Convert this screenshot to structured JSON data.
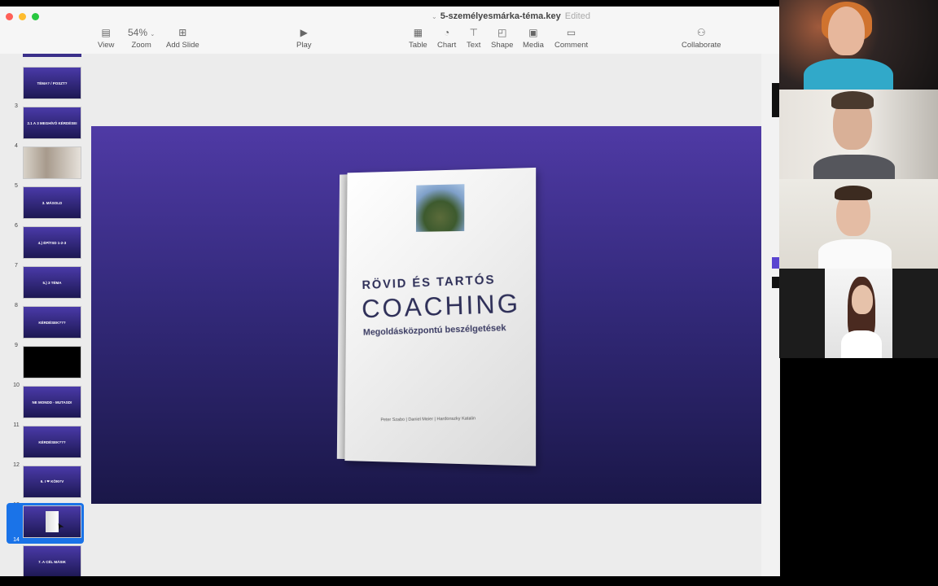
{
  "window": {
    "document_name": "5-személyesmárka-téma.key",
    "status": "Edited"
  },
  "toolbar": {
    "zoom_value": "54%",
    "view": "View",
    "zoom": "Zoom",
    "add_slide": "Add Slide",
    "play": "Play",
    "table": "Table",
    "chart": "Chart",
    "text": "Text",
    "shape": "Shape",
    "media": "Media",
    "comment": "Comment",
    "collaborate": "Collaborate"
  },
  "slides": [
    {
      "num": "3",
      "title": "TÉMA? / POSZT?",
      "style": "purple"
    },
    {
      "num": "4",
      "title": "2.1 A 3 MEGHÍVÓ KÉRDÉSEI",
      "style": "purple"
    },
    {
      "num": "5",
      "title": "",
      "style": "photo"
    },
    {
      "num": "6",
      "title": "3. MÁSOLD",
      "style": "purple"
    },
    {
      "num": "7",
      "title": "4.) ÉPÍTSD 1-2-3",
      "style": "purple"
    },
    {
      "num": "8",
      "title": "5.) 3 TÉMA",
      "style": "purple"
    },
    {
      "num": "9",
      "title": "KÉRDÉSEK???",
      "style": "purple"
    },
    {
      "num": "10",
      "title": "",
      "style": "black"
    },
    {
      "num": "11",
      "title": "NE MONDD - MUTASD!",
      "style": "purple"
    },
    {
      "num": "12",
      "title": "KÉRDÉSEK???",
      "style": "purple"
    },
    {
      "num": "13",
      "title": "6. I ❤ KÖNYV",
      "style": "purple"
    },
    {
      "num": "14",
      "title": "",
      "style": "selected"
    },
    {
      "num": "15",
      "title": "7. A CÉL MÁSIK",
      "style": "purple"
    }
  ],
  "book": {
    "title_line1": "RÖVID ÉS TARTÓS",
    "title_line2": "COACHING",
    "subtitle": "Megoldásközpontú beszélgetések",
    "authors": "Peter Szabo | Daniel Meier | Hardonszky Katalin"
  },
  "colors": {
    "slide_top": "#4f3aa5",
    "slide_bottom": "#1a1748",
    "selection": "#1a73e8"
  }
}
